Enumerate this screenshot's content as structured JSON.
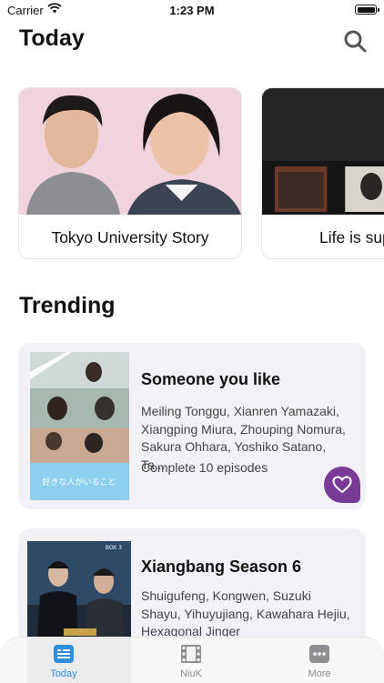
{
  "status": {
    "carrier": "Carrier",
    "time": "1:23 PM"
  },
  "header": {
    "title": "Today"
  },
  "featured": [
    {
      "title": "Tokyo University Story"
    },
    {
      "title": "Life is super good"
    }
  ],
  "trending": {
    "section_title": "Trending",
    "items": [
      {
        "name": "Someone you like",
        "cast": "Meiling Tonggu, Xianren Yamazaki, Xiangping Miura, Zhouping Nomura, Sakura Ohhara, Yoshiko Satano, Ta...",
        "episodes": "Complete 10 episodes",
        "poster_caption": "好きな人がいること"
      },
      {
        "name": "Xiangbang Season 6",
        "cast": "Shuigufeng, Kongwen, Suzuki Shayu, Yihuyujiang, Kawahara Hejiu, Hexagonal Jinger",
        "poster_badge": "BOX 3"
      }
    ]
  },
  "tabs": [
    {
      "label": "Today",
      "icon": "today-icon",
      "active": true
    },
    {
      "label": "NiuK",
      "icon": "film-icon",
      "active": false
    },
    {
      "label": "More",
      "icon": "more-icon",
      "active": false
    }
  ],
  "colors": {
    "accent": "#2f8fd8",
    "favorite": "#7a3b98",
    "card_bg": "#f2f1f7"
  }
}
